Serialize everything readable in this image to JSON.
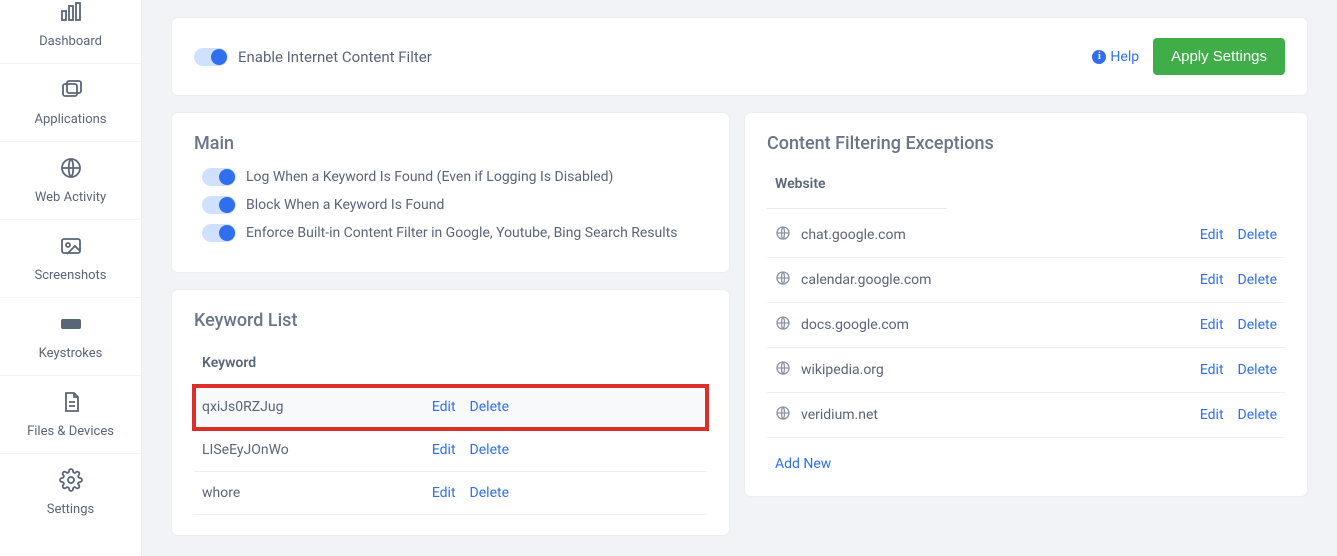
{
  "sidebar": {
    "items": [
      {
        "label": "Dashboard"
      },
      {
        "label": "Applications"
      },
      {
        "label": "Web Activity"
      },
      {
        "label": "Screenshots"
      },
      {
        "label": "Keystrokes"
      },
      {
        "label": "Files & Devices"
      },
      {
        "label": "Settings"
      }
    ]
  },
  "topbar": {
    "toggle_label": "Enable Internet Content Filter",
    "help": "Help",
    "apply": "Apply Settings"
  },
  "main": {
    "title": "Main",
    "opt_log": "Log When a Keyword Is Found (Even if Logging Is Disabled)",
    "opt_block": "Block When a Keyword Is Found",
    "opt_enforce": "Enforce Built-in Content Filter in Google, Youtube, Bing Search Results"
  },
  "keywords": {
    "title": "Keyword List",
    "column": "Keyword",
    "items": [
      {
        "text": "qxiJs0RZJug",
        "highlight": true
      },
      {
        "text": "LISeEyJOnWo",
        "highlight": false
      },
      {
        "text": "whore",
        "highlight": false
      }
    ],
    "edit": "Edit",
    "delete": "Delete"
  },
  "exceptions": {
    "title": "Content Filtering Exceptions",
    "column": "Website",
    "items": [
      {
        "site": "chat.google.com"
      },
      {
        "site": "calendar.google.com"
      },
      {
        "site": "docs.google.com"
      },
      {
        "site": "wikipedia.org"
      },
      {
        "site": "veridium.net"
      }
    ],
    "edit": "Edit",
    "delete": "Delete",
    "add_new": "Add New"
  }
}
